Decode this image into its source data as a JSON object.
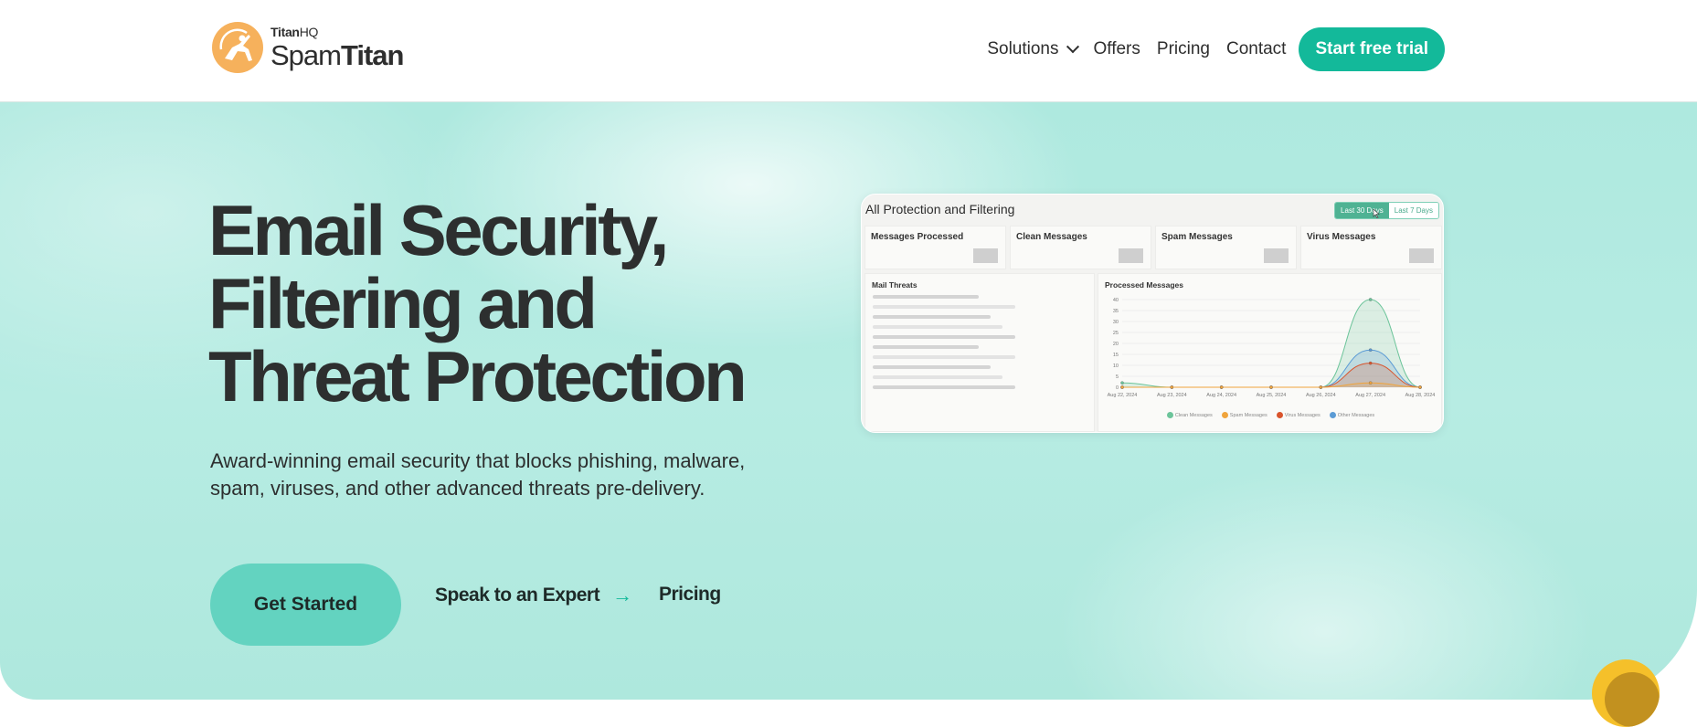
{
  "header": {
    "logo": {
      "brand_prefix": "Titan",
      "brand_suffix": "HQ",
      "product_light": "Spam",
      "product_bold": "Titan"
    },
    "nav": [
      {
        "label": "Solutions",
        "has_dropdown": true
      },
      {
        "label": "Offers"
      },
      {
        "label": "Pricing"
      },
      {
        "label": "Contact"
      }
    ],
    "cta_label": "Start free trial"
  },
  "hero": {
    "headline_lines": [
      "Email Security,",
      "Filtering and",
      "Threat Protection"
    ],
    "subtext": "Award-winning email security that blocks phishing, malware, spam, viruses, and other advanced threats pre-delivery.",
    "primary_button": "Get Started",
    "expert_link": "Speak to an Expert",
    "expert_arrow": "→",
    "pricing_link": "Pricing"
  },
  "dashboard": {
    "title": "All Protection and Filtering",
    "range_options": [
      "Last 30 Days",
      "Last 7 Days"
    ],
    "selected_range": "Last 30 Days",
    "cards": [
      "Messages Processed",
      "Clean Messages",
      "Spam Messages",
      "Virus Messages"
    ],
    "threats_title": "Mail Threats",
    "chart_title": "Processed Messages"
  },
  "chart_data": {
    "type": "area",
    "title": "Processed Messages",
    "x": [
      "Aug 22, 2024",
      "Aug 23, 2024",
      "Aug 24, 2024",
      "Aug 25, 2024",
      "Aug 26, 2024",
      "Aug 27, 2024",
      "Aug 28, 2024"
    ],
    "yticks": [
      0,
      5,
      10,
      15,
      20,
      25,
      30,
      35,
      40
    ],
    "ylim": [
      0,
      40
    ],
    "grid": true,
    "legend_position": "bottom",
    "series": [
      {
        "name": "Clean Messages",
        "color": "#6cc49a",
        "values": [
          2,
          0,
          0,
          0,
          0,
          40,
          0
        ]
      },
      {
        "name": "Spam Messages",
        "color": "#f0a43c",
        "values": [
          0,
          0,
          0,
          0,
          0,
          2,
          0
        ]
      },
      {
        "name": "Virus Messages",
        "color": "#d9542c",
        "values": [
          0,
          0,
          0,
          0,
          0,
          11,
          0
        ]
      },
      {
        "name": "Other Messages",
        "color": "#5b9bd5",
        "values": [
          0,
          0,
          0,
          0,
          0,
          17,
          0
        ]
      }
    ]
  }
}
